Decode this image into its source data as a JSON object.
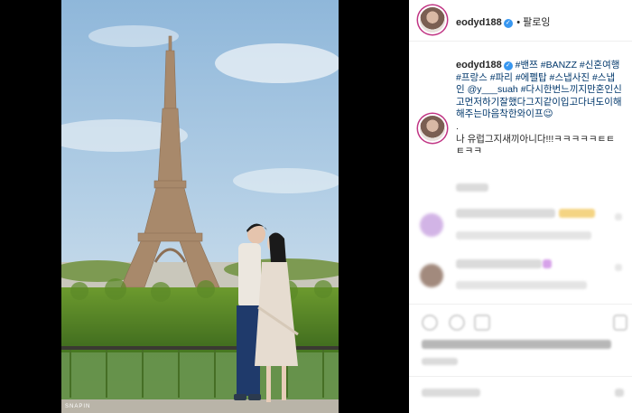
{
  "post": {
    "username": "eodyd188",
    "verified_glyph": "✓",
    "follow_label": "팔로잉",
    "caption_user": "eodyd188",
    "caption_tags": "#밴쯔 #BANZZ #신혼여행 #프랑스 #파리 #에펠탑 #스냅사진 #스냅인 @y___suah #다시한번느끼지만혼인신고먼저하기잘했다그지같이입고다녀도이해해주는마음착한와이프😉",
    "caption_dot": ".",
    "caption_text": "나 유럽그지새끼아니다!!!ㅋㅋㅋㅋㅋㅌㅌㅌㅋㅋ"
  },
  "photo": {
    "watermark": "SNAPIN"
  },
  "colors": {
    "accent": "#3897f0",
    "ring": "#c13584",
    "tag": "#00376b"
  }
}
